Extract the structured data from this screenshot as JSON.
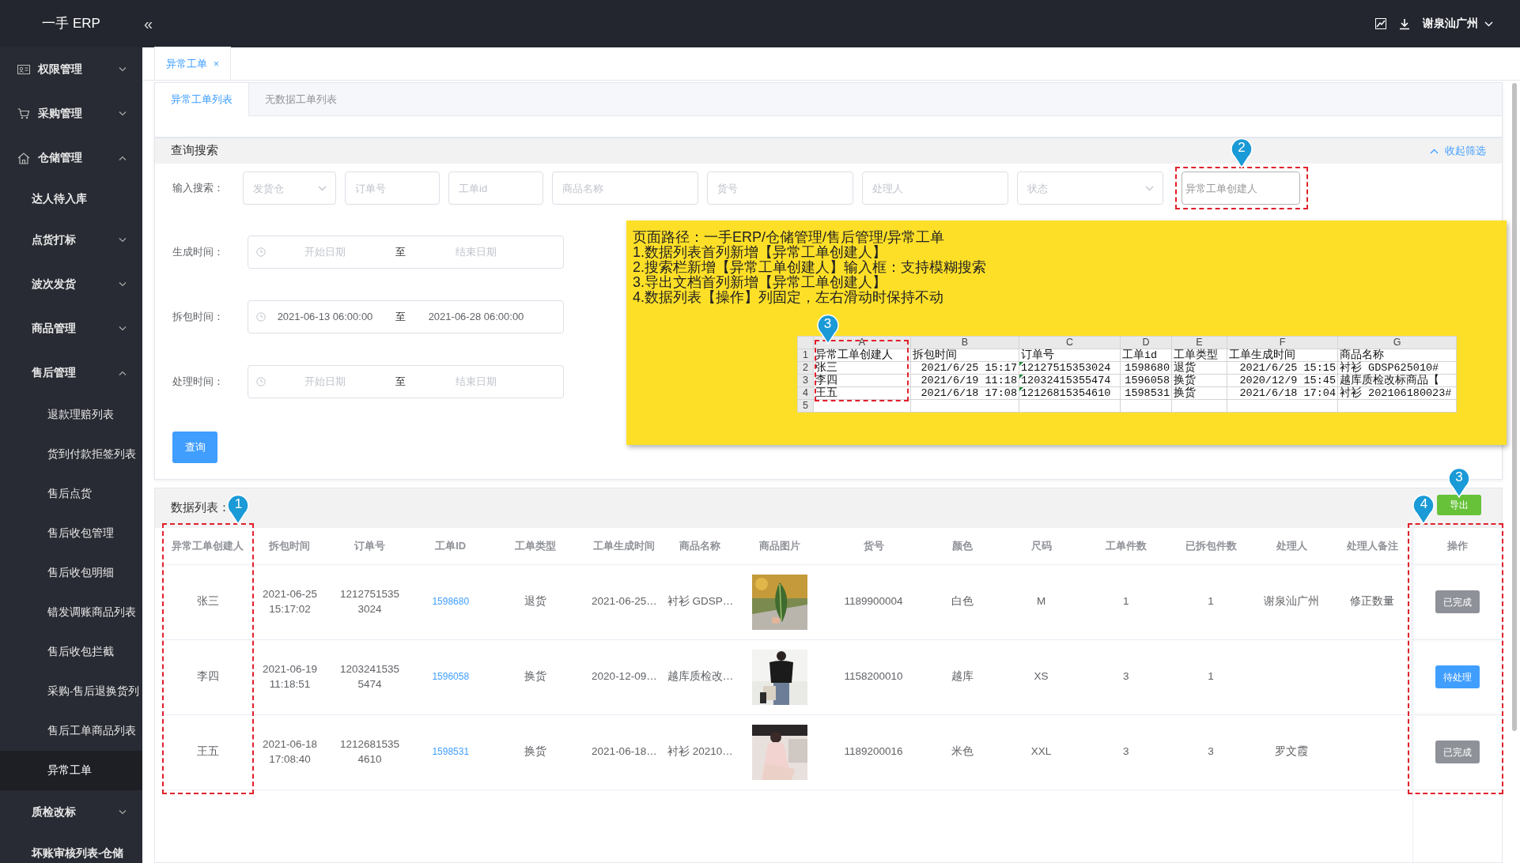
{
  "app": {
    "logo": "一手 ERP",
    "collapse": "«",
    "user": "谢泉汕广州"
  },
  "sidebar": {
    "items": [
      {
        "label": "权限管理",
        "kind": "group",
        "expanded": false
      },
      {
        "label": "采购管理",
        "kind": "group",
        "expanded": false
      },
      {
        "label": "仓储管理",
        "kind": "group",
        "expanded": true,
        "children": [
          {
            "label": "达人待入库",
            "kind": "leaf"
          },
          {
            "label": "点货打标",
            "kind": "group",
            "expanded": false
          },
          {
            "label": "波次发货",
            "kind": "group",
            "expanded": false
          },
          {
            "label": "商品管理",
            "kind": "group",
            "expanded": false
          },
          {
            "label": "售后管理",
            "kind": "group",
            "expanded": true,
            "children": [
              {
                "label": "退款理赔列表",
                "selected": false
              },
              {
                "label": "货到付款拒签列表",
                "selected": false
              },
              {
                "label": "售后点货",
                "selected": false
              },
              {
                "label": "售后收包管理",
                "selected": false
              },
              {
                "label": "售后收包明细",
                "selected": false
              },
              {
                "label": "错发调账商品列表",
                "selected": false
              },
              {
                "label": "售后收包拦截",
                "selected": false
              },
              {
                "label": "采购-售后退换货列",
                "selected": false
              },
              {
                "label": "售后工单商品列表",
                "selected": false
              },
              {
                "label": "异常工单",
                "selected": true
              }
            ]
          },
          {
            "label": "质检改标",
            "kind": "group",
            "expanded": false
          },
          {
            "label": "坏账审核列表-仓储",
            "kind": "leaf"
          }
        ]
      }
    ]
  },
  "page_tabs": [
    {
      "label": "异常工单",
      "close": "×",
      "selected": true
    }
  ],
  "inner_tabs": [
    {
      "label": "异常工单列表",
      "selected": true
    },
    {
      "label": "无数据工单列表",
      "selected": false
    }
  ],
  "search": {
    "title": "查询搜索",
    "collapse_link": "收起筛选",
    "label": "输入搜索：",
    "fields": [
      {
        "kind": "select",
        "placeholder": "发货仓"
      },
      {
        "kind": "input",
        "placeholder": "订单号"
      },
      {
        "kind": "input",
        "placeholder": "工单id"
      },
      {
        "kind": "input",
        "placeholder": "商品名称"
      },
      {
        "kind": "input",
        "placeholder": "货号"
      },
      {
        "kind": "input",
        "placeholder": "处理人"
      },
      {
        "kind": "select",
        "placeholder": "状态"
      },
      {
        "kind": "input",
        "placeholder": "异常工单创建人"
      }
    ],
    "date_rows": [
      {
        "label": "生成时间：",
        "start": {
          "placeholder": "开始日期"
        },
        "separator": "至",
        "end": {
          "placeholder": "结束日期"
        }
      },
      {
        "label": "拆包时间：",
        "start": {
          "value": "2021-06-13 06:00:00"
        },
        "separator": "至",
        "end": {
          "value": "2021-06-28 06:00:00"
        }
      },
      {
        "label": "处理时间：",
        "start": {
          "placeholder": "开始日期"
        },
        "separator": "至",
        "end": {
          "placeholder": "结束日期"
        }
      }
    ],
    "button": "查询"
  },
  "note": {
    "lines": [
      "页面路径：一手ERP/仓储管理/售后管理/异常工单",
      "1.数据列表首列新增【异常工单创建人】",
      "2.搜索栏新增【异常工单创建人】输入框：支持模糊搜索",
      "3.导出文档首列新增【异常工单创建人】",
      "4.数据列表【操作】列固定，左右滑动时保持不动"
    ],
    "sheet": {
      "columns": [
        "A",
        "B",
        "C",
        "D",
        "E",
        "F",
        "G"
      ],
      "rows": [
        {
          "number": "1",
          "cells": [
            "异常工单创建人",
            "拆包时间",
            "订单号",
            "工单id",
            "工单类型",
            "工单生成时间",
            "商品名称"
          ]
        },
        {
          "number": "2",
          "cells": [
            "张三",
            "2021/6/25 15:17",
            "12127515353024",
            "1598680",
            "退货",
            "2021/6/25 15:15",
            "衬衫 GDSP625010#"
          ]
        },
        {
          "number": "3",
          "cells": [
            "李四",
            "2021/6/19 11:18",
            "12032415355474",
            "1596058",
            "换货",
            "2020/12/9 15:45",
            "越库质检改标商品【"
          ]
        },
        {
          "number": "4",
          "cells": [
            "王五",
            "2021/6/18 17:08",
            "12126815354610",
            "1598531",
            "换货",
            "2021/6/18 17:04",
            "衬衫 202106180023#"
          ]
        },
        {
          "number": "5"
        }
      ]
    }
  },
  "data_table": {
    "title": "数据列表：",
    "export_button": "导出",
    "columns": [
      "异常工单创建人",
      "拆包时间",
      "订单号",
      "工单ID",
      "工单类型",
      "工单生成时间",
      "商品名称",
      "商品图片",
      "货号",
      "颜色",
      "尺码",
      "工单件数",
      "已拆包件数",
      "处理人",
      "处理人备注",
      "操作"
    ],
    "rows": [
      {
        "creator": "张三",
        "unpack_time": "2021-06-25 15:17:02",
        "order_no": "12127515353024",
        "ticket_id": "1598680",
        "type": "退货",
        "created": "2021-06-25…",
        "product": "衬衫 GDSP…",
        "sku": "1189900004",
        "product_color": "白色",
        "size": "M",
        "qty": "1",
        "unpacked": "1",
        "handler": "谢泉汕广州",
        "remark": "修正数量",
        "action": {
          "label": "已完成",
          "completed": true
        }
      },
      {
        "creator": "李四",
        "unpack_time": "2021-06-19 11:18:51",
        "order_no": "12032415355474",
        "ticket_id": "1596058",
        "type": "换货",
        "created": "2020-12-09…",
        "product": "越库质检改…",
        "sku": "1158200010",
        "product_color": "越库",
        "size": "XS",
        "qty": "3",
        "unpacked": "1",
        "action": {
          "label": "待处理",
          "completed": false
        }
      },
      {
        "creator": "王五",
        "unpack_time": "2021-06-18 17:08:40",
        "order_no": "12126815354610",
        "ticket_id": "1598531",
        "type": "换货",
        "created": "2021-06-18…",
        "product": "衬衫 20210…",
        "sku": "1189200016",
        "product_color": "米色",
        "size": "XXL",
        "qty": "3",
        "unpacked": "3",
        "handler": "罗文霞",
        "action": {
          "label": "已完成",
          "completed": true
        }
      }
    ]
  },
  "annotations": {
    "pins": [
      {
        "number": "1"
      },
      {
        "number": "2"
      },
      {
        "number": "3"
      },
      {
        "number": "3"
      },
      {
        "number": "4"
      }
    ]
  }
}
